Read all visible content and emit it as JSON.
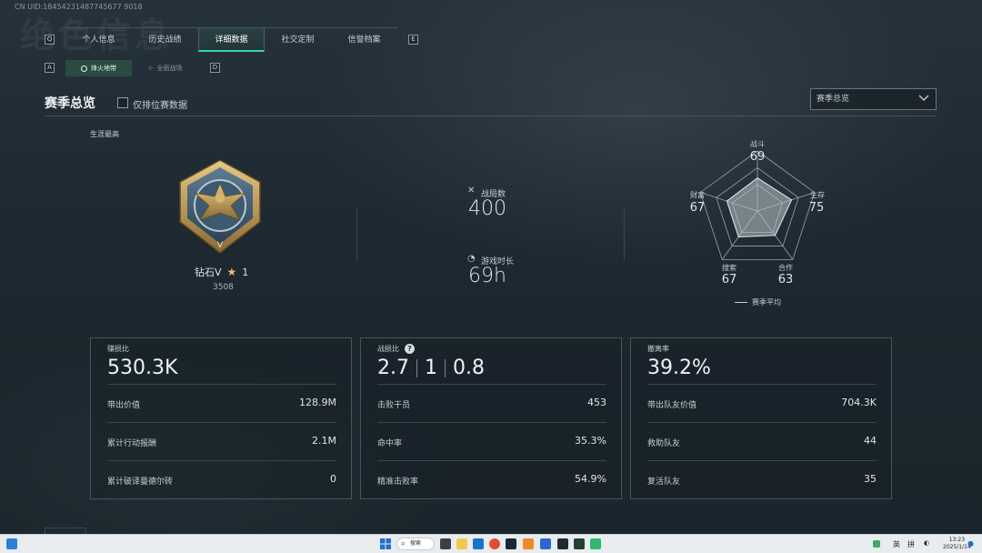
{
  "header": {
    "uid": "CN UID:18454231487745677 9018",
    "bg_title": "绝色信息"
  },
  "keycaps": {
    "left": "Q",
    "right": "E",
    "sub_left": "A",
    "sub_right": "D"
  },
  "tabs": [
    {
      "label": "个人信息",
      "active": false
    },
    {
      "label": "历史战绩",
      "active": false
    },
    {
      "label": "详细数据",
      "active": true
    },
    {
      "label": "社交定制",
      "active": false
    },
    {
      "label": "信誉档案",
      "active": false
    }
  ],
  "subtabs": [
    {
      "label": "烽火地带",
      "active": true
    },
    {
      "label": "全面战场",
      "active": false
    }
  ],
  "section": {
    "title": "赛季总览",
    "checkbox_label": "仅排位赛数据",
    "dropdown_value": "赛季总览"
  },
  "career": {
    "label": "生涯最高",
    "rank": "钻石V",
    "stars": "1",
    "score": "3508"
  },
  "stats": {
    "matches_label": "战局数",
    "matches_value": "400",
    "playtime_label": "游戏时长",
    "playtime_value": "69h"
  },
  "radar": {
    "axes": [
      {
        "label": "战斗",
        "value": 69
      },
      {
        "label": "生存",
        "value": 75
      },
      {
        "label": "合作",
        "value": 63
      },
      {
        "label": "搜索",
        "value": 67
      },
      {
        "label": "财富",
        "value": 67
      }
    ],
    "legend": "赛季平均"
  },
  "cards": {
    "profit": {
      "title": "赚损比",
      "value": "530.3K",
      "rows": [
        {
          "k": "带出价值",
          "v": "128.9M"
        },
        {
          "k": "累计行动报酬",
          "v": "2.1M"
        },
        {
          "k": "累计破译曼德尔砖",
          "v": "0"
        }
      ]
    },
    "kd": {
      "title": "战损比",
      "help": "?",
      "parts": [
        "2.7",
        "1",
        "0.8"
      ],
      "rows": [
        {
          "k": "击败干员",
          "v": "453"
        },
        {
          "k": "命中率",
          "v": "35.3%"
        },
        {
          "k": "精准击败率",
          "v": "54.9%"
        }
      ]
    },
    "extract": {
      "title": "撤离率",
      "value": "39.2%",
      "rows": [
        {
          "k": "带出队友价值",
          "v": "704.3K"
        },
        {
          "k": "救助队友",
          "v": "44"
        },
        {
          "k": "复活队友",
          "v": "35"
        }
      ]
    }
  },
  "taskbar": {
    "search": "搜索",
    "ime1": "英",
    "ime2": "拼",
    "time": "13:23",
    "date": "2025/1/14"
  },
  "colors": {
    "accent": "#34d6a3",
    "star": "#e9c46a"
  }
}
